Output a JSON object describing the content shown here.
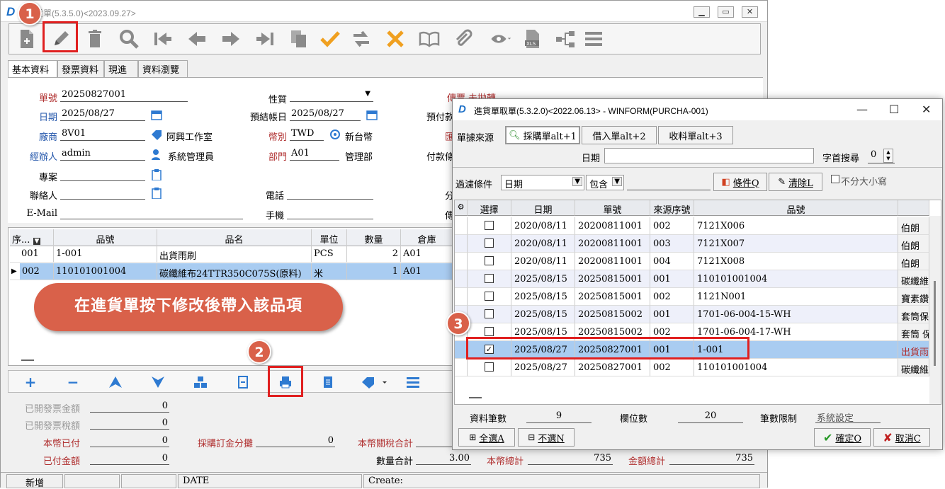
{
  "main": {
    "title": "進貨單(5.3.5.0)<2023.09.27>",
    "tabs": [
      "基本資料",
      "發票資料",
      "現進",
      "資料瀏覽"
    ],
    "form": {
      "doc_no_label": "單號",
      "doc_no": "20250827001",
      "date_label": "日期",
      "date": "2025/08/27",
      "vendor_label": "廠商",
      "vendor_code": "8V01",
      "vendor_name": "阿興工作室",
      "handler_label": "經辦人",
      "handler": "admin",
      "handler_name": "系統管理員",
      "project_label": "專案",
      "contact_label": "聯絡人",
      "email_label": "E-Mail",
      "nature_label": "性質",
      "pre_date_label": "預結帳日",
      "pre_date": "2025/08/27",
      "currency_label": "幣別",
      "currency": "TWD",
      "currency_name": "新台幣",
      "dept_label": "部門",
      "dept": "A01",
      "dept_name": "管理部",
      "phone_label": "電話",
      "mobile_label": "手機",
      "voucher_label": "傳票",
      "voucher": "未拋轉",
      "prepay_label": "預付款",
      "exchange_label": "匯",
      "pay_label": "付款條",
      "extra_label1": "分",
      "extra_label2": "傳"
    },
    "grid_headers": [
      "序...",
      "品號",
      "品名",
      "單位",
      "數量",
      "倉庫"
    ],
    "grid_rows": [
      {
        "seq": "001",
        "code": "1-001",
        "name": "出貨雨刷",
        "unit": "PCS",
        "qty": "2",
        "wh": "A01"
      },
      {
        "seq": "002",
        "code": "110101001004",
        "name": "碳纖維布24TTR350C075S(原料)",
        "unit": "米",
        "qty": "1",
        "wh": "A01"
      }
    ],
    "callout": "在進貨單按下修改後帶入該品項",
    "totals": {
      "inv_amt_label": "已開發票金額",
      "inv_amt": "0",
      "inv_tax_label": "已開發票稅額",
      "inv_tax": "0",
      "paid_local_label": "本幣已付",
      "paid_local": "0",
      "po_deposit_label": "採購訂金分攤",
      "po_deposit": "0",
      "duty_label": "本幣關稅合計",
      "paid_amt_label": "已付金額",
      "paid_amt": "0",
      "qty_total_label": "數量合計",
      "qty_total": "3.00",
      "local_total_label": "本幣總計",
      "local_total": "735",
      "amount_total_label": "金額總計",
      "amount_total": "735"
    },
    "status": {
      "mode": "新增",
      "field": "DATE",
      "create": "Create:"
    }
  },
  "badges": [
    "1",
    "2",
    "3"
  ],
  "dialog": {
    "title": "進貨單取單(5.3.2.0)<2022.06.13> - WINFORM(PURCHA-001)",
    "source_label": "單據來源",
    "source_tabs": [
      "採購單alt+1",
      "借入單alt+2",
      "收料單alt+3"
    ],
    "date_label": "日期",
    "prefix_label": "字首搜尋",
    "prefix_value": "0",
    "filter_label": "過濾條件",
    "filter_field": "日期",
    "filter_op": "包含",
    "cond_btn": "條件Q",
    "clear_btn": "清除L",
    "case_label": "不分大小寫",
    "headers": [
      "選擇",
      "日期",
      "單號",
      "來源序號",
      "品號",
      ""
    ],
    "rows": [
      {
        "checked": false,
        "date": "2020/08/11",
        "no": "20200811001",
        "src": "002",
        "code": "7121X006",
        "name": "伯朗"
      },
      {
        "checked": false,
        "date": "2020/08/11",
        "no": "20200811001",
        "src": "003",
        "code": "7121X007",
        "name": "伯朗"
      },
      {
        "checked": false,
        "date": "2020/08/11",
        "no": "20200811001",
        "src": "004",
        "code": "7121X008",
        "name": "伯朗"
      },
      {
        "checked": false,
        "date": "2025/08/15",
        "no": "20250815001",
        "src": "001",
        "code": "110101001004",
        "name": "碳纖維"
      },
      {
        "checked": false,
        "date": "2025/08/15",
        "no": "20250815001",
        "src": "002",
        "code": "1121N001",
        "name": "寶素鑽"
      },
      {
        "checked": false,
        "date": "2025/08/15",
        "no": "20250815002",
        "src": "001",
        "code": "1701-06-004-15-WH",
        "name": "套筒保"
      },
      {
        "checked": false,
        "date": "2025/08/15",
        "no": "20250815002",
        "src": "002",
        "code": "1701-06-004-17-WH",
        "name": "套筒 保"
      },
      {
        "checked": true,
        "date": "2025/08/27",
        "no": "20250827001",
        "src": "001",
        "code": "1-001",
        "name": "出貨雨"
      },
      {
        "checked": false,
        "date": "2025/08/27",
        "no": "20250827001",
        "src": "002",
        "code": "110101001004",
        "name": "碳纖維"
      }
    ],
    "record_count_label": "資料筆數",
    "record_count": "9",
    "field_count_label": "欄位數",
    "field_count": "20",
    "limit_label": "筆數限制",
    "limit_value": "系統設定",
    "select_all": "全選A",
    "select_none": "不選N",
    "ok": "確定O",
    "cancel": "取消C"
  },
  "colors": {
    "accent": "#2e7ad1",
    "badge": "#d9614a",
    "highlight": "#a9ccf1",
    "label_red": "#b03030",
    "label_blue": "#2255aa"
  }
}
